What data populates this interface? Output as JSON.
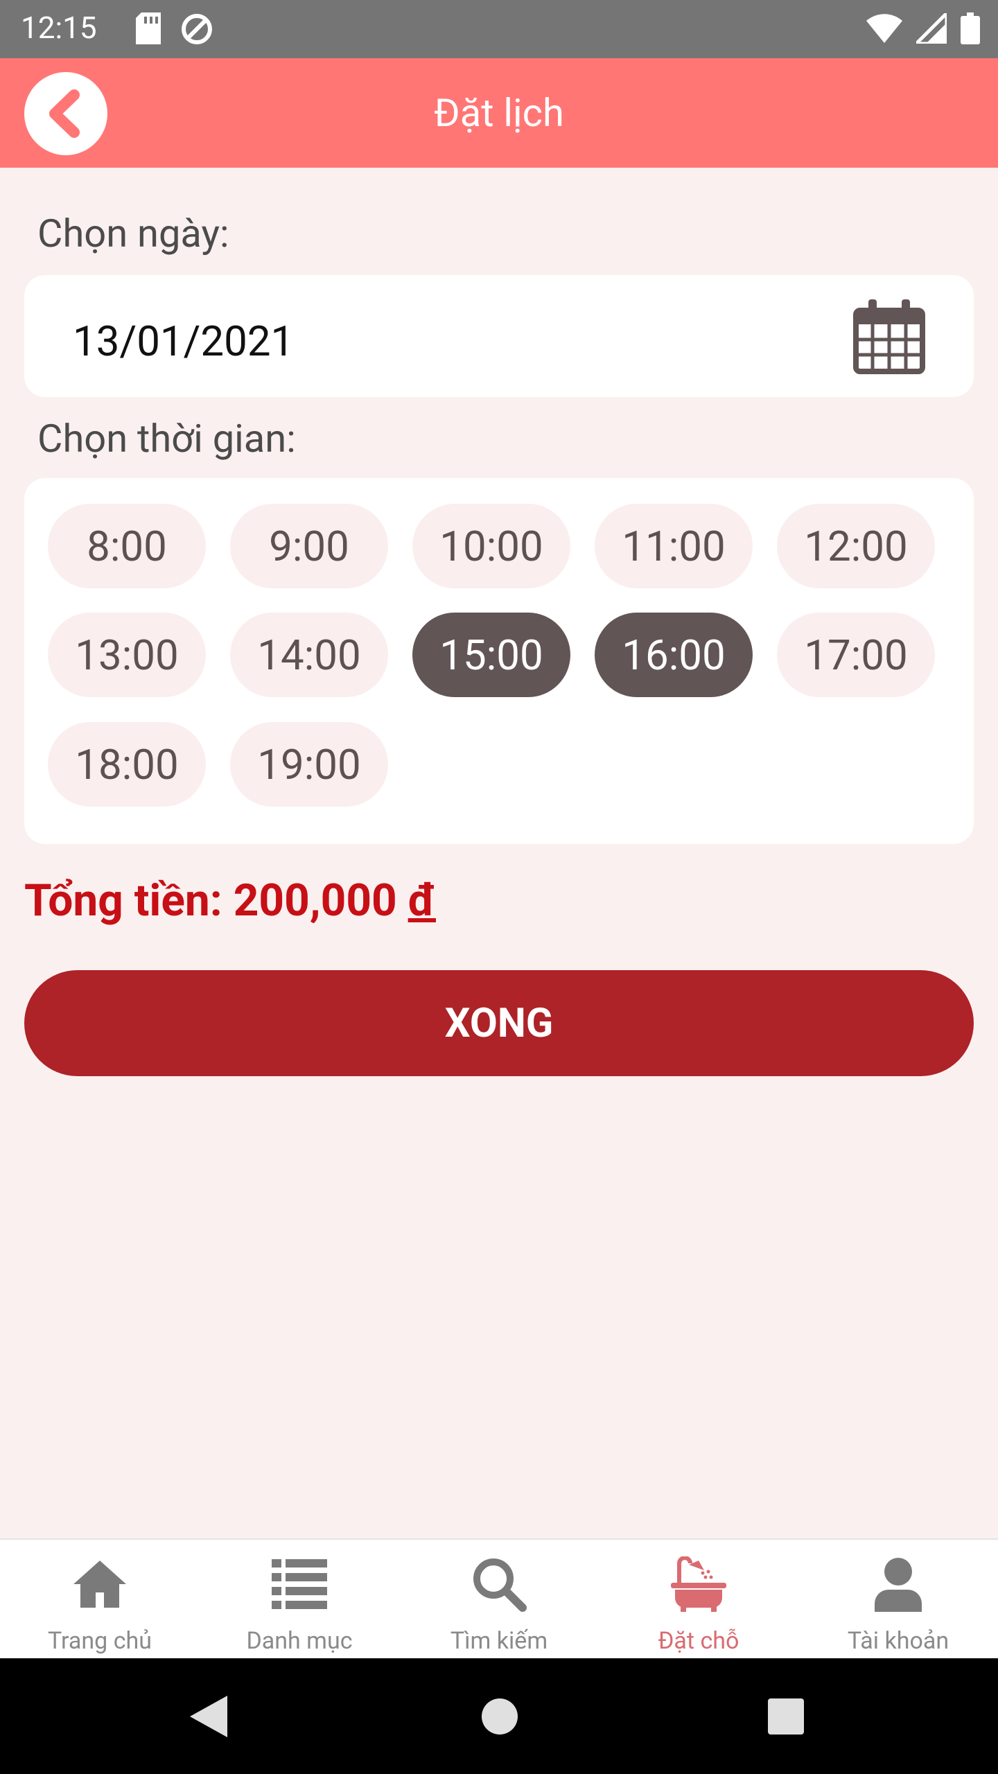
{
  "status_bar": {
    "time": "12:15"
  },
  "header": {
    "title": "Đặt lịch"
  },
  "date_section": {
    "label": "Chọn ngày:",
    "value": "13/01/2021"
  },
  "time_section": {
    "label": "Chọn thời gian:",
    "slots": [
      "8:00",
      "9:00",
      "10:00",
      "11:00",
      "12:00",
      "13:00",
      "14:00",
      "15:00",
      "16:00",
      "17:00",
      "18:00",
      "19:00"
    ],
    "selected": [
      "15:00",
      "16:00"
    ]
  },
  "total": {
    "label": "Tổng tiền:",
    "amount": "200,000",
    "currency": "đ"
  },
  "done_button": {
    "label": "XONG"
  },
  "bottom_nav": {
    "items": [
      {
        "label": "Trang chủ",
        "icon": "home-icon"
      },
      {
        "label": "Danh mục",
        "icon": "list-icon"
      },
      {
        "label": "Tìm kiếm",
        "icon": "search-icon"
      },
      {
        "label": "Đặt chỗ",
        "icon": "bathtub-icon",
        "active": true
      },
      {
        "label": "Tài khoản",
        "icon": "user-icon"
      }
    ]
  },
  "colors": {
    "header": "#ff7675",
    "accent": "#ad2327",
    "total_text": "#c70f16",
    "selected_slot": "#625555",
    "background": "#fbf0f0"
  }
}
